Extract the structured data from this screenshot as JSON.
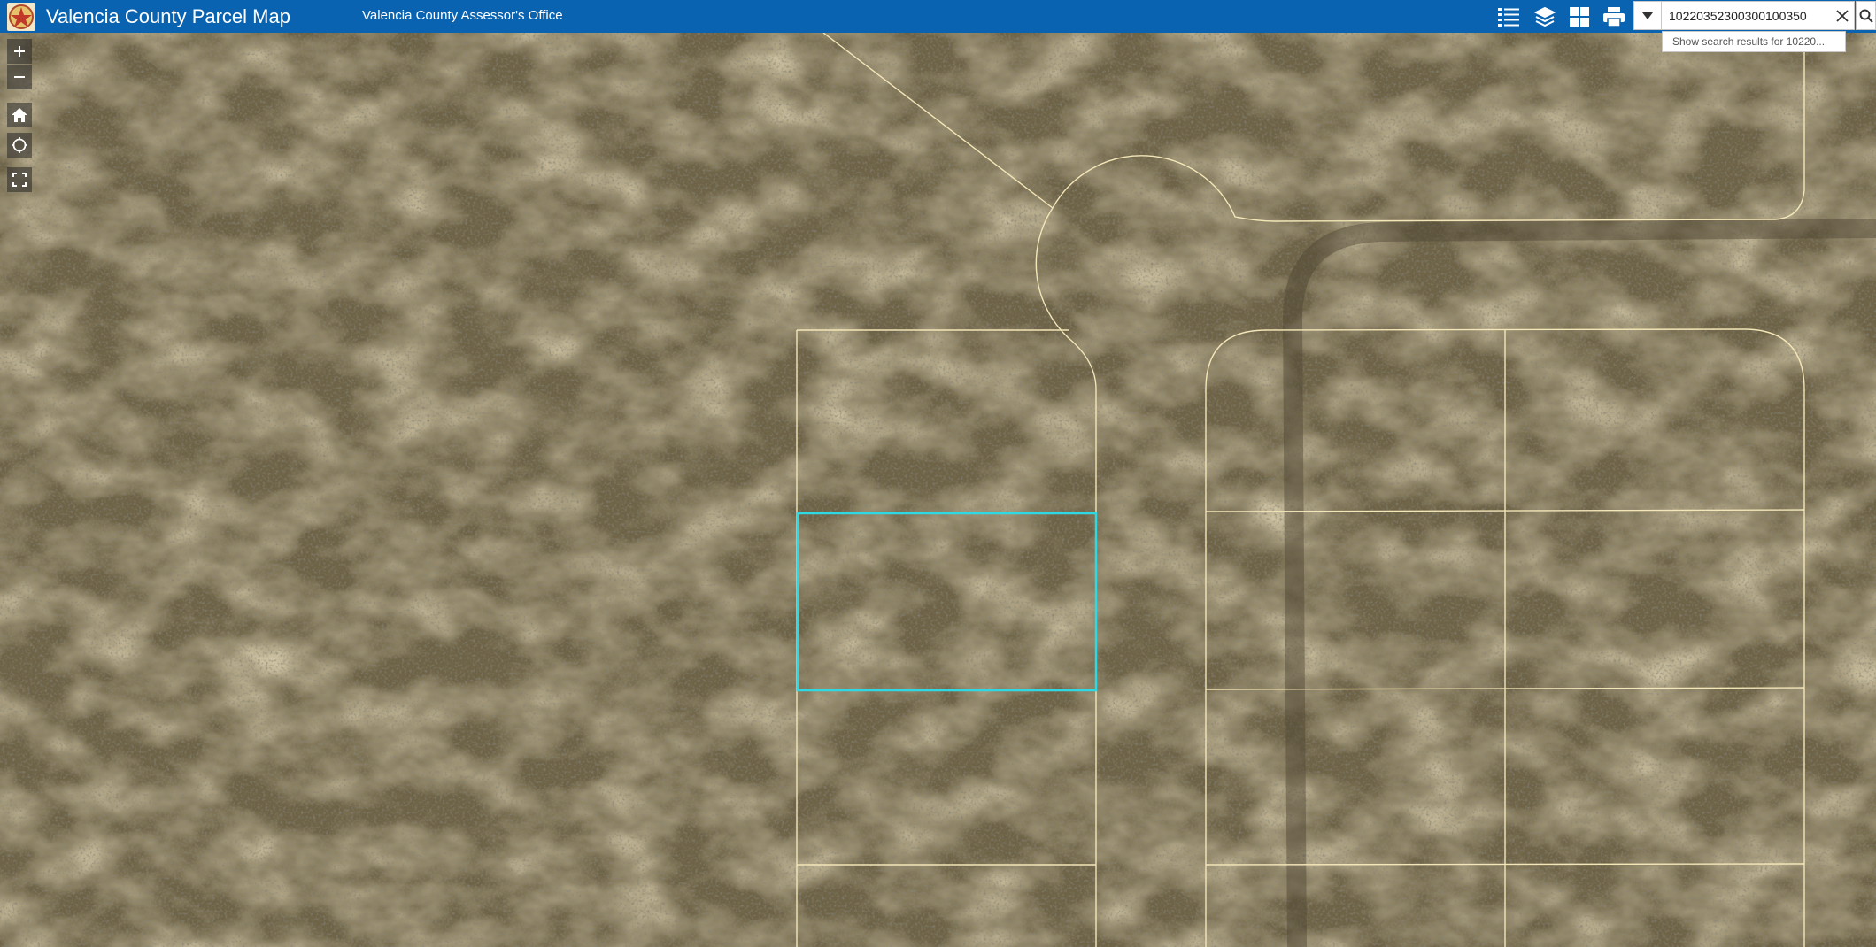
{
  "header": {
    "title": "Valencia County Parcel Map",
    "subtitle": "Valencia County Assessor's Office",
    "logo_icon": "county-seal-icon",
    "tools": [
      {
        "name": "legend-list-icon"
      },
      {
        "name": "layers-icon"
      },
      {
        "name": "basemap-gallery-icon"
      },
      {
        "name": "print-icon"
      }
    ]
  },
  "search": {
    "value": "10220352300300100350",
    "suggestion": "Show search results for 10220...",
    "dropdown_icon": "caret-down-icon",
    "clear_icon": "close-icon",
    "submit_icon": "search-icon"
  },
  "map_controls": [
    {
      "name": "zoom-in-icon",
      "glyph": "+"
    },
    {
      "name": "zoom-out-icon",
      "glyph": "−"
    },
    {
      "name": "home-icon"
    },
    {
      "name": "locate-icon"
    },
    {
      "name": "fullscreen-icon"
    }
  ],
  "colors": {
    "header_bg": "#0a63b0",
    "parcel_line": "#f3e6b8",
    "selected_parcel": "#2fd9e3",
    "terrain_base": "#7a6c4a"
  }
}
